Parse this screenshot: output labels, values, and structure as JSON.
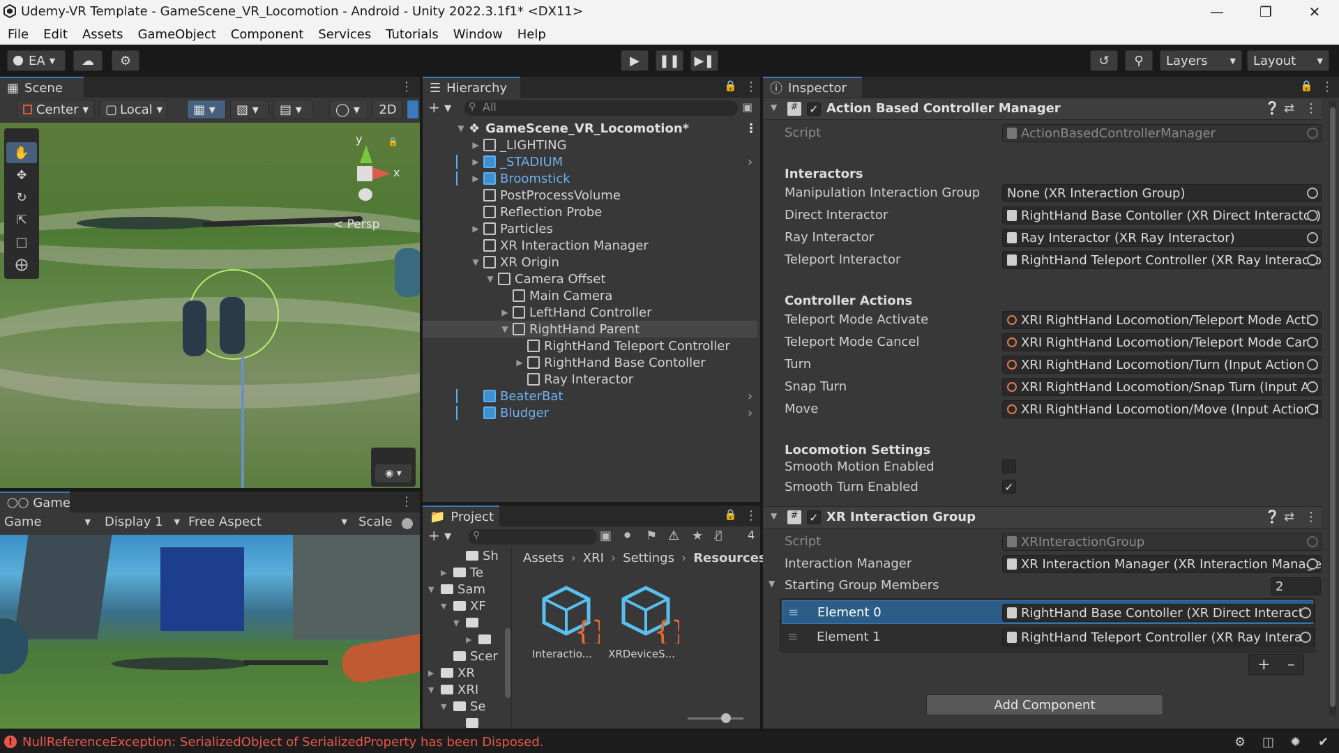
{
  "window": {
    "title": "Udemy-VR Template - GameScene_VR_Locomotion - Android - Unity 2022.3.1f1* <DX11>"
  },
  "menu": [
    "File",
    "Edit",
    "Assets",
    "GameObject",
    "Component",
    "Services",
    "Tutorials",
    "Window",
    "Help"
  ],
  "toolbar": {
    "account": "EA",
    "layers": "Layers",
    "layout": "Layout"
  },
  "scene": {
    "tab": "Scene",
    "pivot": "Center",
    "space": "Local",
    "mode2d": "2D",
    "persp": "< Persp",
    "axis_y": "y",
    "axis_x": "x"
  },
  "game": {
    "tab": "Game",
    "mode": "Game",
    "display": "Display 1",
    "aspect": "Free Aspect",
    "scale": "Scale"
  },
  "hierarchy": {
    "tab": "Hierarchy",
    "search_placeholder": "All",
    "scene_name": "GameScene_VR_Locomotion*",
    "items": [
      {
        "label": "_LIGHTING",
        "blue": false
      },
      {
        "label": "_STADIUM",
        "blue": true
      },
      {
        "label": "Broomstick",
        "blue": true
      },
      {
        "label": "PostProcessVolume",
        "blue": false
      },
      {
        "label": "Reflection Probe",
        "blue": false
      },
      {
        "label": "Particles",
        "blue": false
      },
      {
        "label": "XR Interaction Manager",
        "blue": false
      },
      {
        "label": "XR Origin",
        "blue": false
      },
      {
        "label": "Camera Offset",
        "blue": false
      },
      {
        "label": "Main Camera",
        "blue": false
      },
      {
        "label": "LeftHand Controller",
        "blue": false
      },
      {
        "label": "RightHand Parent",
        "blue": false
      },
      {
        "label": "RightHand Teleport Controller",
        "blue": false
      },
      {
        "label": "RightHand Base Contoller",
        "blue": false
      },
      {
        "label": "Ray Interactor",
        "blue": false
      },
      {
        "label": "BeaterBat",
        "blue": true
      },
      {
        "label": "Bludger",
        "blue": true
      }
    ]
  },
  "project": {
    "tab": "Project",
    "hidden_count": "4",
    "breadcrumb": [
      "Assets",
      "XRI",
      "Settings",
      "Resources"
    ],
    "tree": [
      "Sh",
      "Te",
      "Sam",
      "XF",
      "",
      "",
      "Scer",
      "XR",
      "XRI",
      "Se",
      ""
    ],
    "assets": [
      "Interactio...",
      "XRDeviceS..."
    ]
  },
  "inspector": {
    "tab": "Inspector",
    "comp1": {
      "title": "Action Based Controller Manager",
      "script_label": "Script",
      "script_value": "ActionBasedControllerManager",
      "interactors_header": "Interactors",
      "rows": [
        {
          "label": "Manipulation Interaction Group",
          "value": "None (XR Interaction Group)"
        },
        {
          "label": "Direct Interactor",
          "value": "RightHand Base Contoller (XR Direct Interactor)"
        },
        {
          "label": "Ray Interactor",
          "value": "Ray Interactor (XR Ray Interactor)"
        },
        {
          "label": "Teleport Interactor",
          "value": "RightHand Teleport Controller (XR Ray Interacto"
        }
      ],
      "actions_header": "Controller Actions",
      "actions": [
        {
          "label": "Teleport Mode Activate",
          "value": "XRI RightHand Locomotion/Teleport Mode Activ"
        },
        {
          "label": "Teleport Mode Cancel",
          "value": "XRI RightHand Locomotion/Teleport Mode Canc"
        },
        {
          "label": "Turn",
          "value": "XRI RightHand Locomotion/Turn (Input Action R"
        },
        {
          "label": "Snap Turn",
          "value": "XRI RightHand Locomotion/Snap Turn (Input Ac"
        },
        {
          "label": "Move",
          "value": "XRI RightHand Locomotion/Move (Input Action I"
        }
      ],
      "locomotion_header": "Locomotion Settings",
      "smooth_motion_label": "Smooth Motion Enabled",
      "smooth_turn_label": "Smooth Turn Enabled"
    },
    "comp2": {
      "title": "XR Interaction Group",
      "script_label": "Script",
      "script_value": "XRInteractionGroup",
      "manager_label": "Interaction Manager",
      "manager_value": "XR Interaction Manager (XR Interaction Manage",
      "members_label": "Starting Group Members",
      "members_count": "2",
      "elements": [
        {
          "label": "Element 0",
          "value": "RightHand Base Contoller (XR Direct Interacto"
        },
        {
          "label": "Element 1",
          "value": "RightHand Teleport Controller (XR Ray Interac"
        }
      ]
    },
    "add_component": "Add Component"
  },
  "status": {
    "message": "NullReferenceException: SerializedObject of SerializedProperty has been Disposed."
  },
  "colors": {
    "accent": "#3a79bb",
    "selected_row": "#2c5d87",
    "error": "#e8584a",
    "prefab_blue": "#6fb0f0"
  }
}
